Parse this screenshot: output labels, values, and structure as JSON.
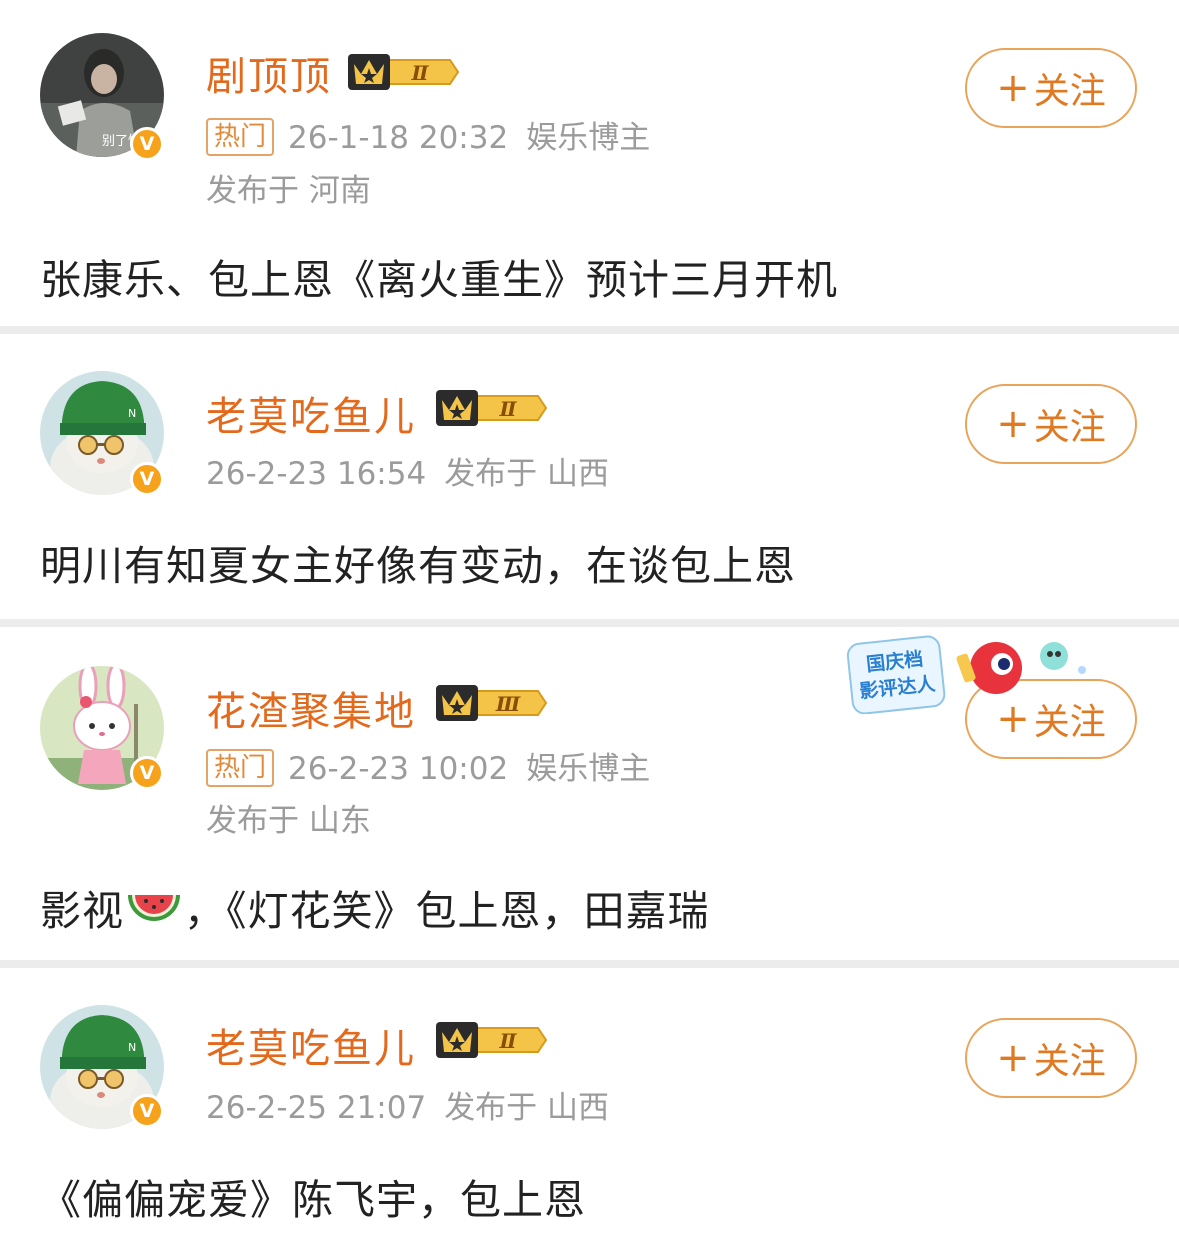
{
  "posts": [
    {
      "username": "剧顶顶",
      "level": "Ⅱ",
      "hot_tag": "热门",
      "timestamp": "26-1-18 20:32",
      "category": "娱乐博主",
      "location": "发布于 河南",
      "follow_label": "关注",
      "content": "张康乐、包上恩《离火重生》预计三月开机",
      "avatar_caption": "别了快去"
    },
    {
      "username": "老莫吃鱼儿",
      "level": "Ⅱ",
      "timestamp": "26-2-23 16:54",
      "location": "发布于 山西",
      "follow_label": "关注",
      "content": "明川有知夏女主好像有变动，在谈包上恩"
    },
    {
      "username": "花渣聚集地",
      "level": "Ⅲ",
      "hot_tag": "热门",
      "timestamp": "26-2-23 10:02",
      "category": "娱乐博主",
      "location": "发布于 山东",
      "follow_label": "关注",
      "content_prefix": "影视",
      "content_suffix": "，《灯花笑》包上恩，田嘉瑞",
      "sticker_text_1": "国庆档",
      "sticker_text_2": "影评达人"
    },
    {
      "username": "老莫吃鱼儿",
      "level": "Ⅱ",
      "timestamp": "26-2-25 21:07",
      "location": "发布于 山西",
      "follow_label": "关注",
      "content": "《偏偏宠爱》陈飞宇，包上恩"
    }
  ],
  "common": {
    "plus_symbol": "+",
    "verified_symbol": "V",
    "colors": {
      "username": "#e36a1d",
      "meta": "#9b9b9b",
      "follow_border": "#e9a45b",
      "verified": "#f7a21b"
    },
    "icons": [
      "crown-level-icon",
      "verified-badge-icon",
      "watermelon-icon",
      "plus-icon"
    ]
  }
}
